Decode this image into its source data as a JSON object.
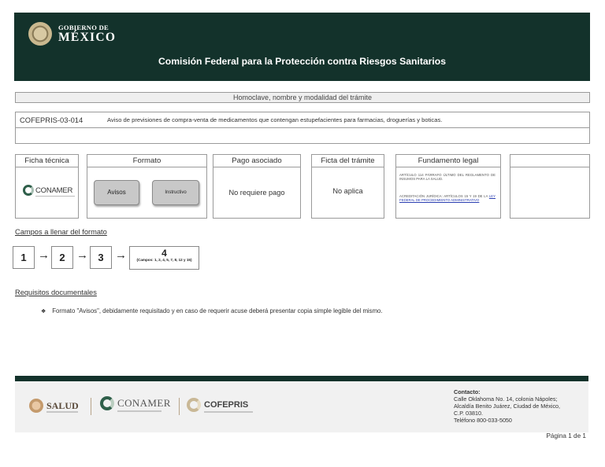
{
  "header": {
    "gobierno_small": "GOBIERNO DE",
    "gobierno_big": "MÉXICO",
    "title": "Comisión Federal para la Protección contra Riesgos Sanitarios"
  },
  "tramite_header": "Homoclave, nombre y modalidad del trámite",
  "tramite": {
    "code": "COFEPRIS-03-014",
    "description": "Aviso de previsiones de compra-venta de medicamentos que contengan estupefacientes para farmacias, droguerías y boticas."
  },
  "columns": {
    "ficha_tecnica": "Ficha técnica",
    "formato": "Formato",
    "pago_asociado": "Pago asociado",
    "ficha_tramite": "Ficta del trámite",
    "fundamento_legal": "Fundamento legal"
  },
  "conamer_small": "CONAMER",
  "formato_buttons": {
    "avisos": "Avisos",
    "instructivo": "Instructivo"
  },
  "pago_text": "No requiere pago",
  "ficta_text": "No aplica",
  "fundamento": {
    "articulo": "ARTÍCULO 114 PÁRRAFO ÚLTIMO DEL REGLAMENTO DE INSUMOS PARA LA SALUD.",
    "acreditacion": "ACREDITACIÓN JURÍDICA: ARTÍCULOS 15 Y 19 DE LA",
    "ley_link": "LEY FEDERAL DE PROCEDIMIENTO ADMINISTRATIVO"
  },
  "campos_title": "Campos a llenar del formato",
  "steps": {
    "s1": "1",
    "s2": "2",
    "s3": "3",
    "s4": "4",
    "s4_note": "(Campos: 1, 2, 4, 5, 7, 8, 12 y 15)",
    "arrow": "→"
  },
  "requisitos_title": "Requisitos documentales",
  "requisitos": [
    "Formato  \"Avisos\", debidamente requisitado y en caso de requerir acuse deberá presentar copia simple legible del mismo."
  ],
  "bullet_glyph": "❖",
  "footer": {
    "salud": "SALUD",
    "conamer": "CONAMER",
    "cofepris": "COFEPRIS",
    "contact_label": "Contacto:",
    "contact_line1": "Calle Oklahoma No. 14, colonia Nápoles;",
    "contact_line2": "Alcaldía Benito Juárez, Ciudad de México,",
    "contact_line3": "C.P. 03810.",
    "contact_line4": "Teléfono 800-033-5050"
  },
  "page_number": "Página 1 de 1",
  "colors": {
    "header_green": "#13322b",
    "button_gray": "#c8c8c8",
    "link_blue": "#2a3eb1"
  },
  "icons": [
    "mexico-seal-icon",
    "conamer-logo-icon",
    "salud-logo-icon",
    "cofepris-logo-icon",
    "arrow-right-icon",
    "diamond-bullet-icon"
  ]
}
